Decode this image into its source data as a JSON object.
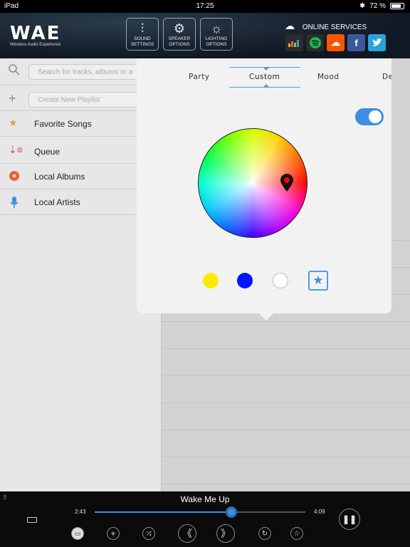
{
  "status": {
    "device": "iPad",
    "time": "17:25",
    "battery": "72 %"
  },
  "header": {
    "logo": "WAE",
    "logo_sub": "Wireless Audio Experience",
    "buttons": [
      {
        "line1": "SOUND",
        "line2": "SETTINGS"
      },
      {
        "line1": "SPEAKER",
        "line2": "OPTIONS"
      },
      {
        "line1": "LIGHTING",
        "line2": "OPTIONS"
      }
    ],
    "online_label": "ONLINE SERVICES",
    "services": [
      "deezer-icon",
      "spotify-icon",
      "soundcloud-icon",
      "facebook-icon",
      "twitter-icon"
    ]
  },
  "sidebar": {
    "search_placeholder": "Search for tracks, albums or a",
    "playlist_placeholder": "Create New Playlist",
    "items": [
      {
        "label": "Favorite Songs",
        "icon": "star-icon"
      },
      {
        "label": "Queue",
        "icon": "queue-icon"
      },
      {
        "label": "Local Albums",
        "icon": "album-icon"
      },
      {
        "label": "Local Artists",
        "icon": "microphone-icon"
      }
    ]
  },
  "lighting": {
    "tabs": [
      "Party",
      "Custom",
      "Mood",
      "De"
    ],
    "active_tab": "Custom",
    "toggle_on": true,
    "swatches": [
      "#ffea00",
      "#0015ff",
      "#ffffff"
    ],
    "accent": "#3e8fe0"
  },
  "player": {
    "title": "Wake Me Up",
    "elapsed": "2:43",
    "duration": "4:09",
    "progress": 0.65
  }
}
